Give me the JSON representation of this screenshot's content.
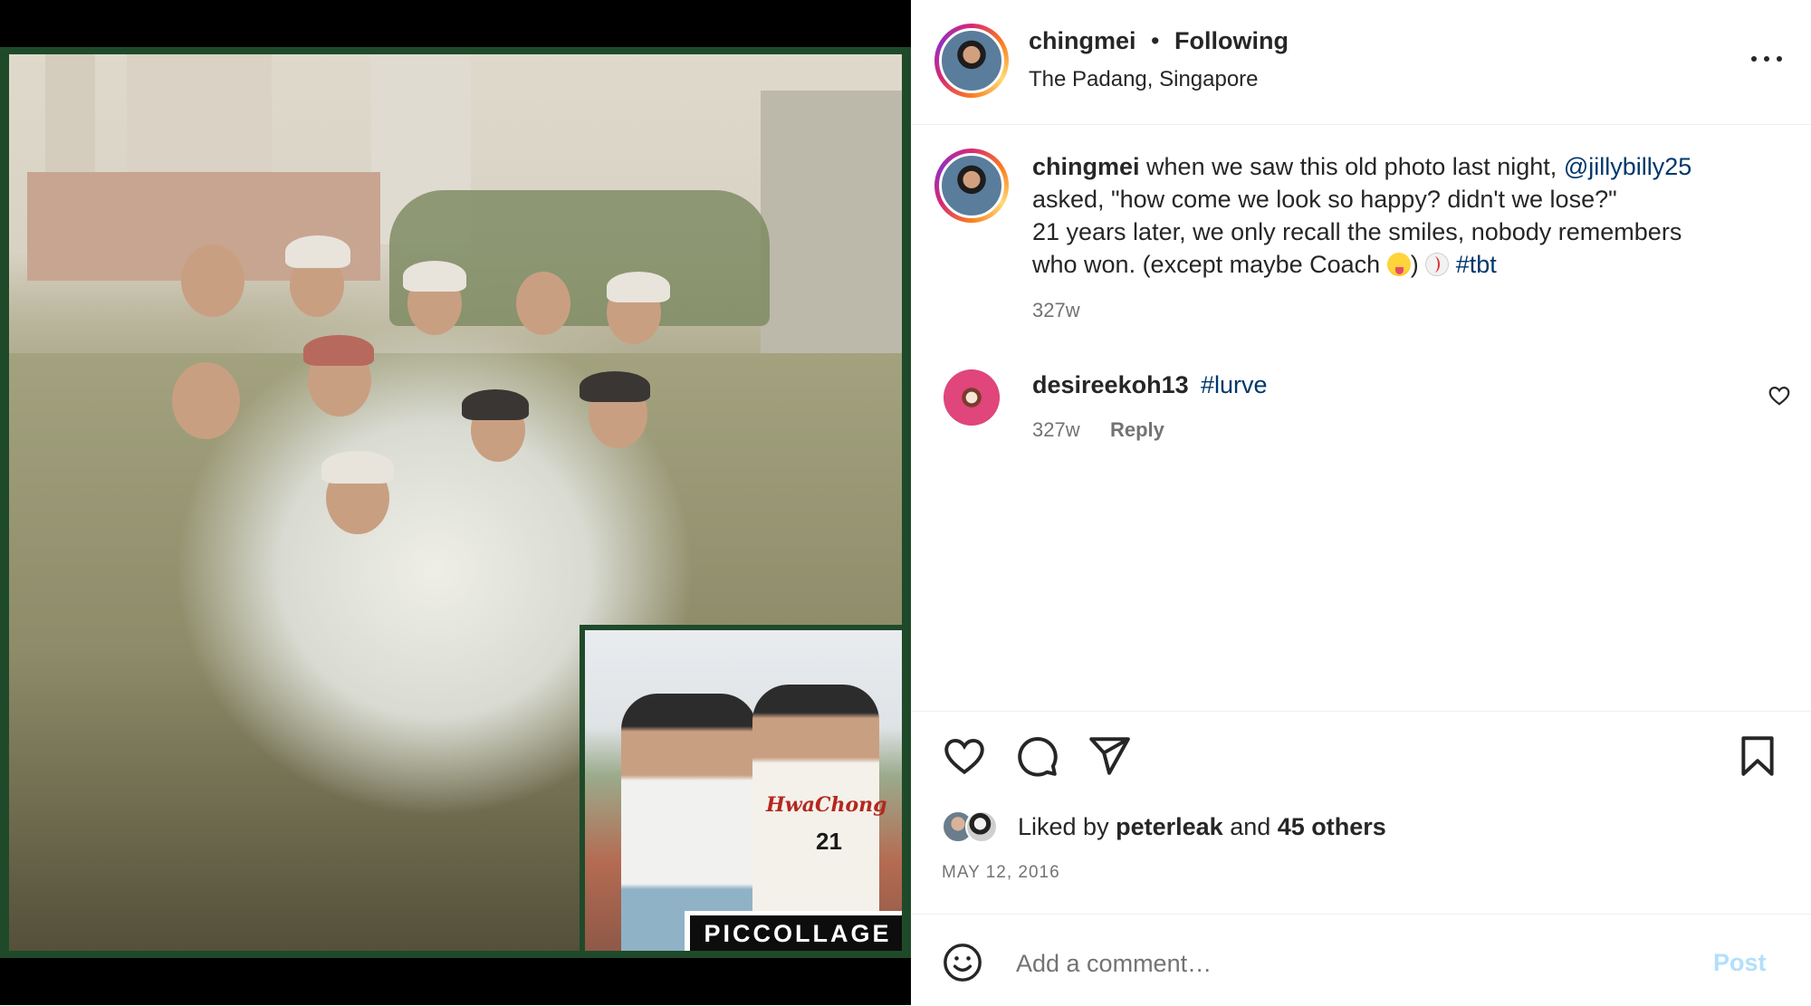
{
  "post": {
    "username": "chingmei",
    "separator": "•",
    "follow_status": "Following",
    "location": "The Padang, Singapore",
    "caption": {
      "username": "chingmei",
      "line1_text": "when we saw this old photo last night,",
      "mention": "@jillybilly25",
      "line2": "asked, \"how come we look so happy? didn't we lose?\"",
      "line3": "21 years later, we only recall the smiles, nobody remembers",
      "line4_text": "who won. (except maybe Coach",
      "line4_close": ")",
      "hashtag": "#tbt",
      "emoji_1": "face-with-tongue-emoji",
      "emoji_2": "baseball-emoji",
      "time": "327w"
    },
    "comments": [
      {
        "username": "desireekoh13",
        "text": "#lurve",
        "time": "327w",
        "reply_label": "Reply"
      }
    ],
    "likes": {
      "prefix": "Liked by",
      "user": "peterleak",
      "joiner": "and",
      "others": "45 others"
    },
    "date": "MAY 12, 2016",
    "add_comment": {
      "placeholder": "Add a comment…",
      "post_label": "Post"
    }
  },
  "media": {
    "watermark": "PICCOLLAGE",
    "inset_jersey_text": "HwaChong",
    "inset_jersey_number": "21"
  },
  "icons": {
    "more": "more-horizontal-icon",
    "like": "heart-icon",
    "comment": "comment-bubble-icon",
    "share": "paper-plane-icon",
    "save": "bookmark-icon",
    "emoji": "smiley-face-icon",
    "comment_like": "small-heart-icon"
  },
  "colors": {
    "link": "#00376b",
    "muted": "#737373",
    "post_disabled": "#b2dffc",
    "text": "#262626"
  }
}
